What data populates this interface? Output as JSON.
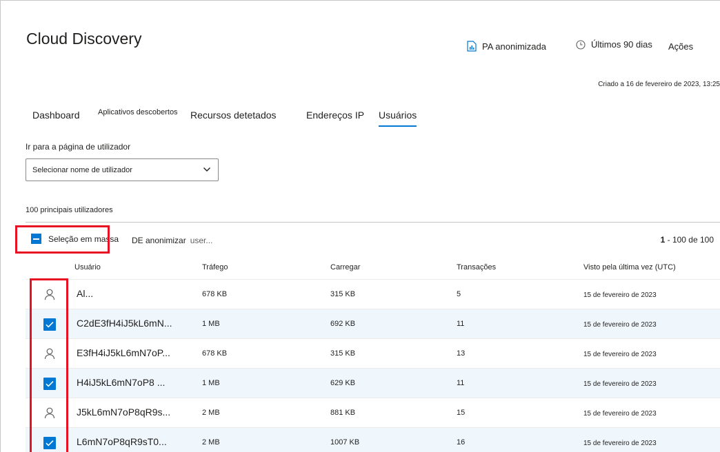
{
  "page": {
    "title": "Cloud Discovery",
    "header_actions": {
      "report": "PA anonimizada",
      "period": "Últimos 90 dias",
      "actions": "Ações"
    },
    "created": "Criado a 16 de fevereiro de 2023, 13:25"
  },
  "tabs": [
    {
      "label": "Dashboard"
    },
    {
      "label": "Aplicativos descobertos"
    },
    {
      "label": "Recursos detetados"
    },
    {
      "label": "Endereços IP"
    },
    {
      "label": "Usuários",
      "active": true
    }
  ],
  "goto": {
    "label": "Ir para a página de utilizador",
    "select_value": "Selecionar nome de utilizador"
  },
  "table_title": "100 principais utilizadores",
  "toolbar": {
    "bulk_select": "Seleção em massa",
    "deanonymize": "DE anonimizar",
    "deanonymize_suffix": "user...",
    "pager_range": "1",
    "pager_rest": "- 100 de 100"
  },
  "columns": {
    "user": "Usuário",
    "traffic": "Tráfego",
    "upload": "Carregar",
    "transactions": "Transações",
    "last_seen": "Visto pela última vez (UTC)"
  },
  "rows": [
    {
      "user": "Al...",
      "traffic": "678 KB",
      "upload": "315 KB",
      "transactions": "5",
      "last_seen": "15 de fevereiro de 2023",
      "selected": false
    },
    {
      "user": "C2dE3fH4iJ5kL6mN...",
      "traffic": "1 MB",
      "upload": "692 KB",
      "transactions": "11",
      "last_seen": "15 de fevereiro de 2023",
      "selected": true
    },
    {
      "user": "E3fH4iJ5kL6mN7oP...",
      "traffic": "678 KB",
      "upload": "315 KB",
      "transactions": "13",
      "last_seen": "15 de fevereiro de 2023",
      "selected": false
    },
    {
      "user": "H4iJ5kL6mN7oP8 ...",
      "traffic": "1 MB",
      "upload": "629 KB",
      "transactions": "11",
      "last_seen": "15 de fevereiro de 2023",
      "selected": true
    },
    {
      "user": "J5kL6mN7oP8qR9s...",
      "traffic": "2 MB",
      "upload": "881 KB",
      "transactions": "15",
      "last_seen": "15 de fevereiro de 2023",
      "selected": false
    },
    {
      "user": "L6mN7oP8qR9sT0...",
      "traffic": "2 MB",
      "upload": "1007 KB",
      "transactions": "16",
      "last_seen": "15 de fevereiro de 2023",
      "selected": true
    }
  ],
  "colors": {
    "accent": "#0078d4",
    "highlight": "#e81123",
    "selected_row": "#eff6fc"
  },
  "icons": {
    "report": "report-icon",
    "clock": "clock-icon",
    "user": "person-icon",
    "check": "checkbox-checked-icon",
    "chevron": "chevron-down-icon"
  }
}
